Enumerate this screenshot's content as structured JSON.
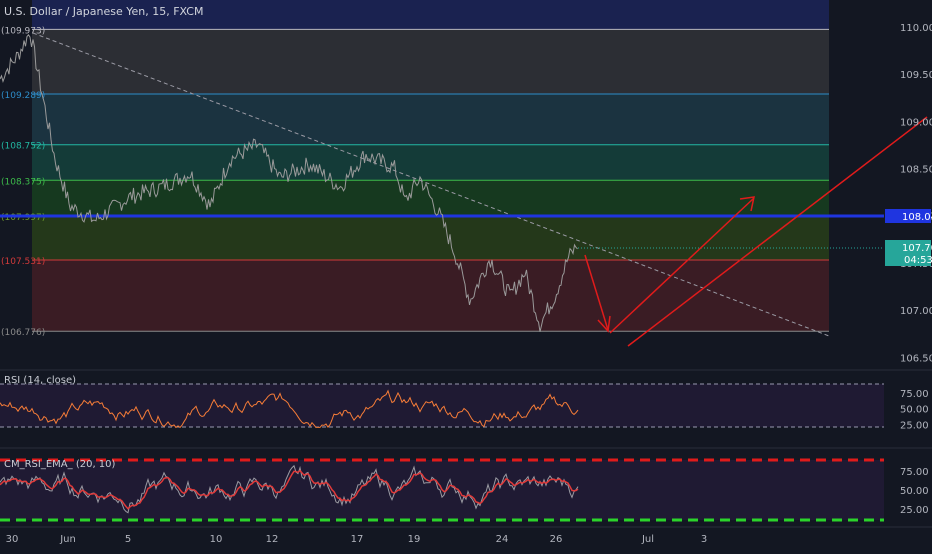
{
  "header": {
    "title": "U.S. Dollar / Japanese Yen, 15, FXCM"
  },
  "colors": {
    "background": "#131722",
    "price_line": "#8f8f8f",
    "rsi_line": "#f57c38",
    "cm_rsi_ema_line": "#e03a3a",
    "cm_rsi_raw": "#9b9ba3",
    "annotation_arrow": "#e01b1b",
    "level_line_blue": "#1f35e0",
    "upper_band_red": "#e01b1b",
    "lower_band_green": "#2bd32b"
  },
  "price_axis": {
    "ticks": [
      "110.000",
      "109.500",
      "109.000",
      "108.500",
      "108.000",
      "107.500",
      "107.000",
      "106.500"
    ],
    "badge_level": "108.045",
    "badge_last": "107.707",
    "badge_countdown": "04:53",
    "min": 106.45,
    "max": 110.2
  },
  "fib_levels": [
    {
      "label": "(109.973)",
      "value": 109.973,
      "line_color": "#b8b8c0",
      "band_color": "#2c2e34"
    },
    {
      "label": "(109.289)",
      "value": 109.289,
      "line_color": "#2d8cc8",
      "band_color": "#1b3340"
    },
    {
      "label": "(108.752)",
      "value": 108.752,
      "line_color": "#22b8a3",
      "band_color": "#143b38"
    },
    {
      "label": "(108.375)",
      "value": 108.375,
      "line_color": "#3dbb4b",
      "band_color": "#16391f"
    },
    {
      "label": "(107.997)",
      "value": 107.997,
      "line_color": "#6f9d2c",
      "band_color": "#24381a"
    },
    {
      "label": "(107.531)",
      "value": 107.531,
      "line_color": "#d13a3a",
      "band_color": "#3a1c24"
    },
    {
      "label": "(106.776)",
      "value": 106.776,
      "line_color": "#8a8a8a",
      "band_color": "#3a1c24"
    }
  ],
  "rsi_panel": {
    "label": "RSI (14, close)",
    "ticks": [
      "75.00",
      "50.00",
      "25.00"
    ],
    "upper": 70,
    "lower": 30
  },
  "cm_panel": {
    "label": "CM_RSI_EMA_ (20, 10)",
    "ticks": [
      "75.00",
      "50.00",
      "25.00"
    ],
    "upper": 85,
    "lower": 15
  },
  "time_axis": {
    "labels": [
      "30",
      "Jun",
      "5",
      "10",
      "12",
      "17",
      "19",
      "24",
      "26",
      "Jul",
      "3"
    ]
  },
  "chart_data": {
    "type": "line",
    "title": "U.S. Dollar / Japanese Yen, 15, FXCM",
    "series": [
      {
        "name": "USDJPY",
        "x": [
          "30",
          "Jun",
          "5",
          "10",
          "12",
          "17",
          "19",
          "24",
          "26"
        ],
        "values_approx": [
          109.8,
          108.2,
          108.0,
          108.55,
          108.6,
          108.6,
          108.0,
          107.3,
          107.71
        ]
      }
    ],
    "ylim": [
      106.45,
      110.2
    ]
  }
}
